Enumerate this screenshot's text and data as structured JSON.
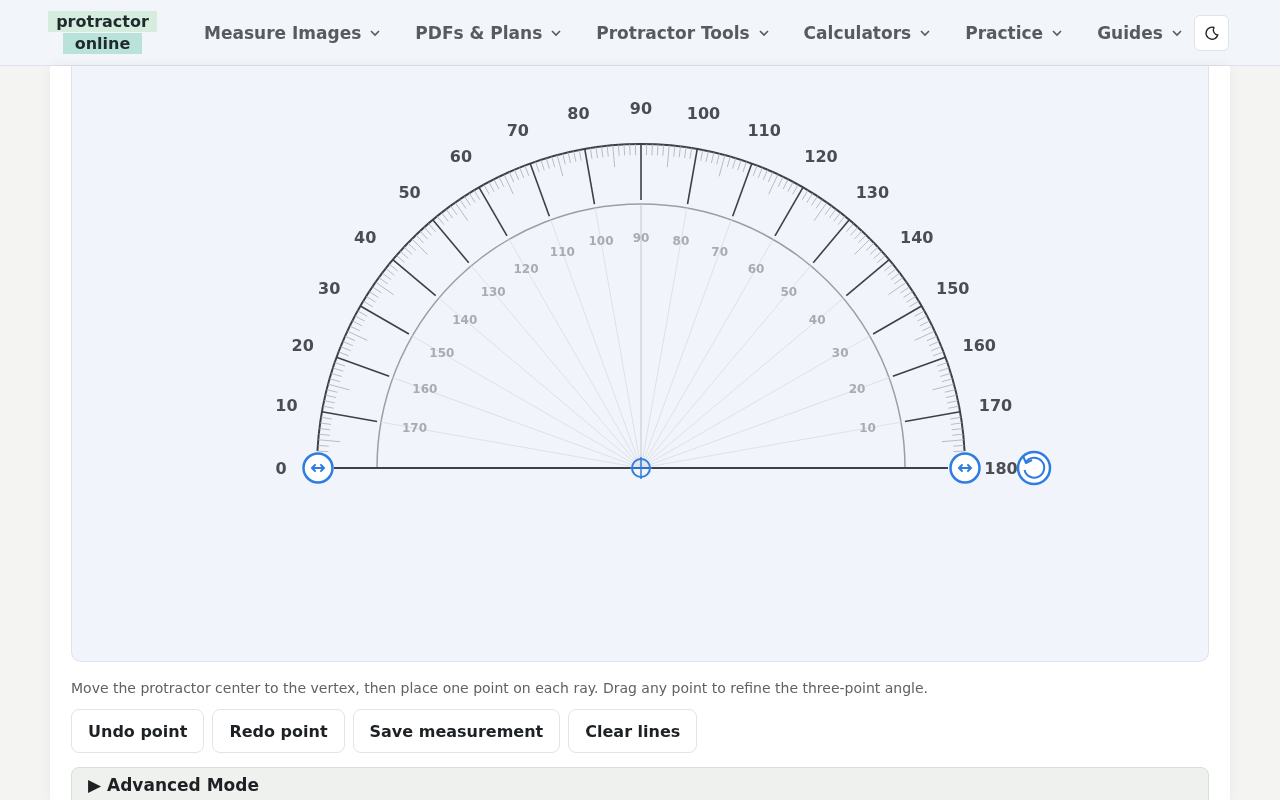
{
  "logo": {
    "line_1": "protractor",
    "line_2": "online"
  },
  "nav": [
    {
      "label": "Measure Images"
    },
    {
      "label": "PDFs & Plans"
    },
    {
      "label": "Protractor Tools"
    },
    {
      "label": "Calculators"
    },
    {
      "label": "Practice"
    },
    {
      "label": "Guides"
    }
  ],
  "protractor": {
    "outer_labels": [
      "0",
      "10",
      "20",
      "30",
      "40",
      "50",
      "60",
      "70",
      "80",
      "90",
      "100",
      "110",
      "120",
      "130",
      "140",
      "150",
      "160",
      "170",
      "180"
    ],
    "inner_labels": [
      "170",
      "160",
      "150",
      "140",
      "130",
      "120",
      "110",
      "100",
      "90",
      "80",
      "70",
      "60",
      "50",
      "40",
      "30",
      "20",
      "10"
    ]
  },
  "hint": "Move the protractor center to the vertex, then place one point on each ray. Drag any point to refine the three-point angle.",
  "buttons": [
    "Undo point",
    "Redo point",
    "Save measurement",
    "Clear lines"
  ],
  "advanced": {
    "marker": "▶",
    "label": "Advanced Mode"
  }
}
